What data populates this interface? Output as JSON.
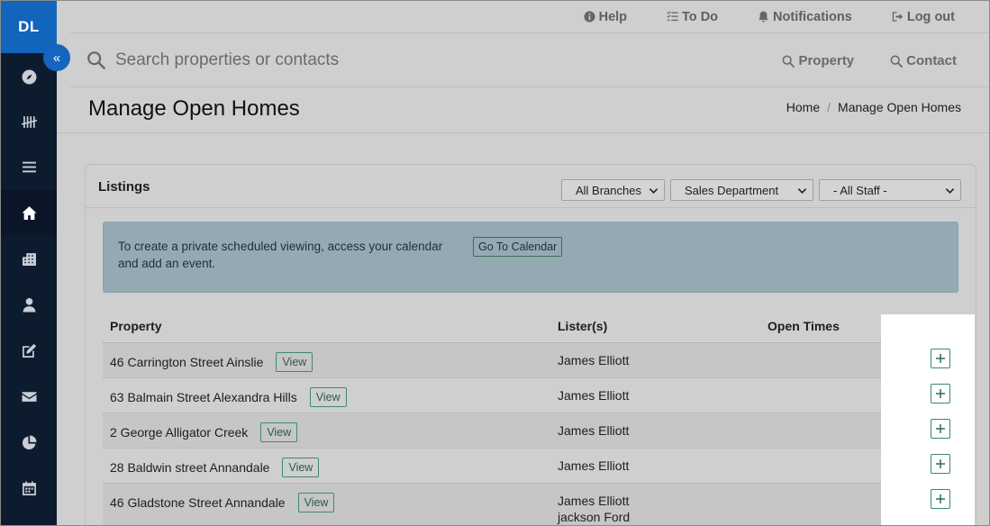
{
  "app": {
    "logo_text": "DL"
  },
  "colors": {
    "sidebar": "#0d1b2f",
    "brand": "#1165bd",
    "accent_green": "#3a8a6c",
    "info_box": "#95a9b3"
  },
  "sidebar": {
    "collapse_icon": "double-chevron-left-icon",
    "collapse_glyph": "«",
    "items": [
      {
        "icon": "compass-icon",
        "active": false
      },
      {
        "icon": "tally-icon",
        "active": false
      },
      {
        "icon": "list-icon",
        "active": false
      },
      {
        "icon": "home-icon",
        "active": true
      },
      {
        "icon": "building-icon",
        "active": false
      },
      {
        "icon": "user-icon",
        "active": false
      },
      {
        "icon": "edit-icon",
        "active": false
      },
      {
        "icon": "envelope-icon",
        "active": false
      },
      {
        "icon": "pie-chart-icon",
        "active": false
      },
      {
        "icon": "calendar-icon",
        "active": false
      }
    ]
  },
  "topbar": {
    "help": "Help",
    "todo": "To Do",
    "notifications": "Notifications",
    "logout": "Log out"
  },
  "search": {
    "placeholder": "Search properties or contacts",
    "property_button": "Property",
    "contact_button": "Contact"
  },
  "page": {
    "title": "Manage Open Homes",
    "breadcrumb": [
      "Home",
      "Manage Open Homes"
    ]
  },
  "listings": {
    "title": "Listings",
    "filters": {
      "branch": "All Branches",
      "department": "Sales Department",
      "staff": "- All Staff -"
    },
    "info": {
      "text": "To create a private scheduled viewing, access your calendar and add an event.",
      "button": "Go To Calendar"
    },
    "columns": [
      "Property",
      "Lister(s)",
      "Open Times"
    ],
    "view_label": "View",
    "rows": [
      {
        "property": "46 Carrington Street Ainslie",
        "listers": [
          "James Elliott"
        ]
      },
      {
        "property": "63 Balmain Street Alexandra Hills",
        "listers": [
          "James Elliott"
        ]
      },
      {
        "property": "2 George Alligator Creek",
        "listers": [
          "James Elliott"
        ]
      },
      {
        "property": "28 Baldwin street Annandale",
        "listers": [
          "James Elliott"
        ]
      },
      {
        "property": "46 Gladstone Street Annandale",
        "listers": [
          "James Elliott",
          "jackson Ford"
        ]
      }
    ]
  }
}
